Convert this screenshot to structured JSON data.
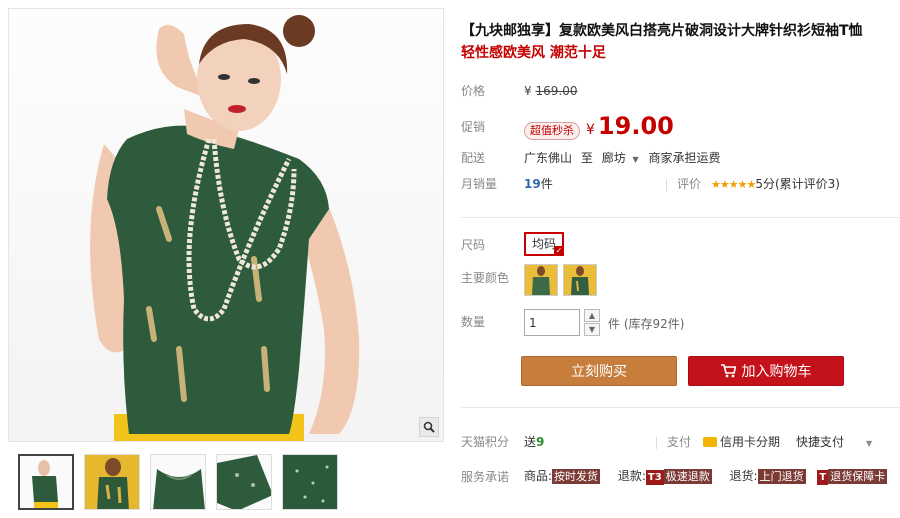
{
  "product": {
    "title": "【九块邮独享】复款欧美风白搭亮片破洞设计大牌针织衫短袖T恤",
    "subtitle": "轻性感欧美风 潮范十足"
  },
  "price": {
    "label": "价格",
    "currency": "¥",
    "original": "169.00",
    "promo_label": "促销",
    "promo_badge": "超值秒杀",
    "current": "19.00"
  },
  "delivery": {
    "label": "配送",
    "from": "广东佛山",
    "to_word": "至",
    "destination": "廊坊",
    "shipping_note": "商家承担运费"
  },
  "sales": {
    "label": "月销量",
    "count": "19",
    "unit": "件",
    "review_label": "评价",
    "stars": "★★★★★",
    "score": "5分(累计评价3)"
  },
  "size": {
    "label": "尺码",
    "options": [
      "均码"
    ]
  },
  "color": {
    "label": "主要颜色",
    "swatch_names": [
      "color-swatch-front",
      "color-swatch-back"
    ]
  },
  "quantity": {
    "label": "数量",
    "value": "1",
    "unit": "件",
    "stock": "(库存92件)"
  },
  "actions": {
    "buy_now": "立刻购买",
    "add_to_cart": "加入购物车"
  },
  "points": {
    "label": "天猫积分",
    "send_word": "送",
    "value": "9"
  },
  "payment": {
    "label": "支付",
    "card_installment": "信用卡分期",
    "quick_pay": "快捷支付"
  },
  "service": {
    "label": "服务承诺",
    "goods_label": "商品:",
    "goods_tag": "按时发货",
    "refund_label": "退款:",
    "refund_tag_code": "T3",
    "refund_tag": "极速退款",
    "return_label": "退货:",
    "return_tag": "上门退货",
    "return2_tag_code": "T",
    "return2_tag": "退货保障卡"
  },
  "colors": {
    "price_red": "#c40000",
    "buy_button": "#c77d3c",
    "cart_button": "#c4121b",
    "link_blue": "#3366aa",
    "star_orange": "#f59b00"
  }
}
